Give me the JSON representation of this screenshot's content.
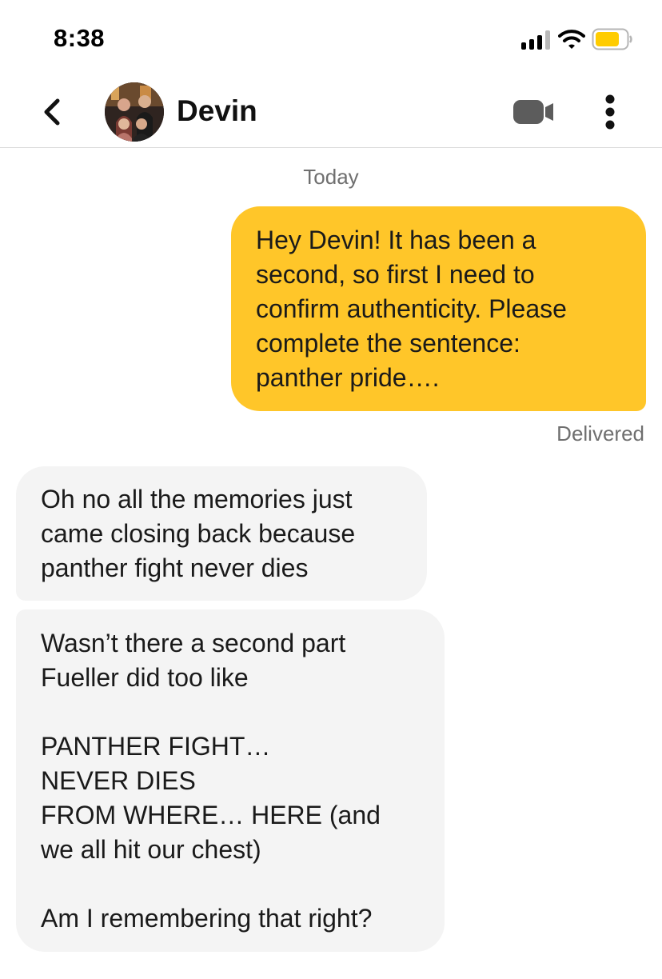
{
  "status_bar": {
    "time": "8:38",
    "battery_color": "#ffcc00"
  },
  "header": {
    "contact_name": "Devin",
    "icons": {
      "back": "chevron-left-icon",
      "video": "video-camera-icon",
      "more": "more-vertical-icon"
    }
  },
  "conversation": {
    "day_label": "Today",
    "messages": [
      {
        "direction": "outgoing",
        "text": "Hey Devin! It has been a\nsecond, so first I need to\nconfirm authenticity. Please\ncomplete the sentence:\npanther pride…."
      },
      {
        "direction": "incoming",
        "text": "Oh no all the memories just\ncame closing back because\npanther fight never dies"
      },
      {
        "direction": "incoming",
        "text": "Wasn’t there a second part\nFueller did too like\n\nPANTHER FIGHT…\nNEVER DIES\nFROM WHERE… HERE (and\nwe all hit our chest)\n\nAm I remembering that right?"
      }
    ],
    "receipt": "Delivered"
  },
  "colors": {
    "outgoing_bubble": "#ffc629",
    "incoming_bubble": "#f4f4f4"
  }
}
